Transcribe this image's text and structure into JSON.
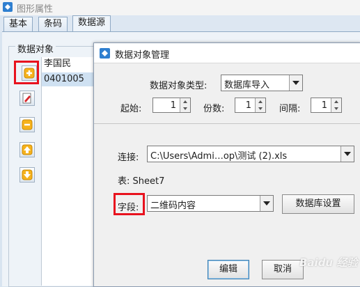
{
  "outer_window": {
    "title": "图形属性",
    "tabs": [
      {
        "label": "基本"
      },
      {
        "label": "条码"
      },
      {
        "label": "数据源"
      }
    ],
    "objects_group_label": "数据对象",
    "object_list": [
      "李国民",
      "0401005"
    ],
    "side_buttons": [
      {
        "icon": "plus-icon"
      },
      {
        "icon": "edit-icon"
      },
      {
        "icon": "minus-icon"
      },
      {
        "icon": "arrow-up-icon"
      },
      {
        "icon": "arrow-down-icon"
      }
    ]
  },
  "dialog": {
    "title": "数据对象管理",
    "type_label": "数据对象类型:",
    "type_value": "数据库导入",
    "start_label": "起始:",
    "start_value": "1",
    "copies_label": "份数:",
    "copies_value": "1",
    "interval_label": "间隔:",
    "interval_value": "1",
    "connection_label": "连接:",
    "connection_value": "C:\\Users\\Admi…op\\测试 (2).xls",
    "table_label": "表: Sheet7",
    "field_label": "字段:",
    "field_value": "二维码内容",
    "db_settings_button": "数据库设置",
    "edit_button": "编辑",
    "cancel_button": "取消"
  },
  "highlight_color": "#e8121e",
  "watermark": "Baidu 经验"
}
